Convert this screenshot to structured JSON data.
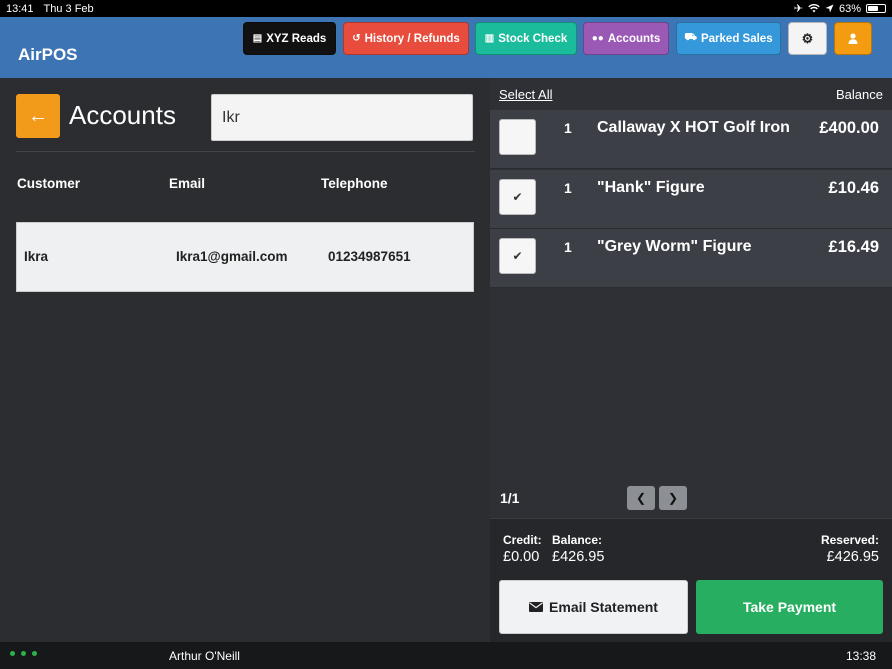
{
  "status_bar": {
    "time": "13:41",
    "date": "Thu 3 Feb",
    "battery": "63%",
    "battery_level": 0.63,
    "icons": [
      "airplane-icon",
      "wifi-icon",
      "location-icon",
      "battery-icon"
    ]
  },
  "header": {
    "app_title": "AirPOS",
    "buttons": {
      "xyz_reads": "XYZ Reads",
      "history_refunds": "History / Refunds",
      "stock_check": "Stock Check",
      "accounts": "Accounts",
      "parked_sales": "Parked Sales"
    },
    "colors": {
      "bar": "#3d74b3",
      "xyz": "#111111",
      "history": "#e74c3c",
      "stock": "#1abc9c",
      "accounts": "#9b59b6",
      "parked": "#3498db",
      "settings": "#f4f4f4",
      "user": "#f39c12"
    }
  },
  "left": {
    "back_icon": "←",
    "title": "Accounts",
    "search_value": "Ikr",
    "columns": {
      "customer": "Customer",
      "email": "Email",
      "telephone": "Telephone"
    },
    "rows": [
      {
        "customer": "Ikra",
        "email": "Ikra1@gmail.com",
        "telephone": "01234987651"
      }
    ]
  },
  "right": {
    "select_all": "Select All",
    "balance_header": "Balance",
    "items": [
      {
        "qty": "1",
        "name": "Callaway X HOT Golf Iron",
        "price": "£400.00",
        "checked": false
      },
      {
        "qty": "1",
        "name": "\"Hank\" Figure",
        "price": "£10.46",
        "checked": true
      },
      {
        "qty": "1",
        "name": "\"Grey Worm\" Figure",
        "price": "£16.49",
        "checked": true
      }
    ],
    "pager": "1/1",
    "summary": {
      "credit_label": "Credit:",
      "credit_value": "£0.00",
      "balance_label": "Balance:",
      "balance_value": "£426.95",
      "reserved_label": "Reserved:",
      "reserved_value": "£426.95"
    },
    "email_statement": "Email Statement",
    "take_payment": "Take Payment"
  },
  "bottom": {
    "user": "Arthur O'Neill",
    "time": "13:38"
  }
}
